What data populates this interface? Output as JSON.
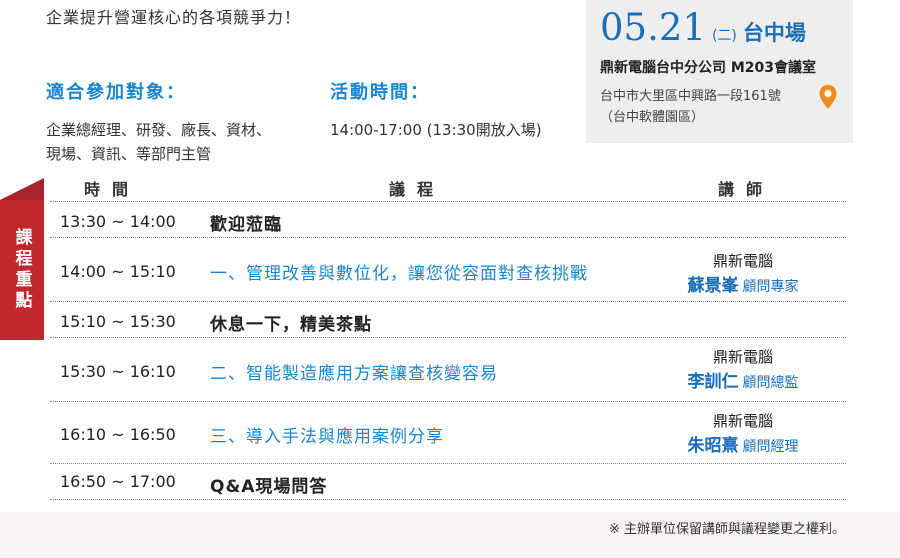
{
  "intro": "企業提升營運核心的各項競爭力！",
  "audience": {
    "heading": "適合參加對象：",
    "line1": "企業總經理、研發、廠長、資材、",
    "line2": "現場、資訊、等部門主管"
  },
  "event_time": {
    "heading": "活動時間：",
    "text": "14:00-17:00 (13:30開放入場)"
  },
  "date_box": {
    "date": "05.21",
    "weekday": "(二)",
    "venue": "台中場",
    "place": "鼎新電腦台中分公司 M203會議室",
    "address": "台中市大里區中興路一段161號",
    "address_note": "（台中軟體園區）"
  },
  "side_tab": "課程重點",
  "table": {
    "headers": {
      "time": "時間",
      "agenda": "議程",
      "speaker": "講師"
    },
    "rows": [
      {
        "time": "13:30 ~ 14:00",
        "topic": "歡迎蒞臨"
      },
      {
        "time": "14:00 ~ 15:10",
        "topic": "一、管理改善與數位化，讓您從容面對查核挑戰",
        "org": "鼎新電腦",
        "name": "蘇景峯",
        "title": "顧問專家"
      },
      {
        "time": "15:10 ~ 15:30",
        "topic": "休息一下，精美茶點"
      },
      {
        "time": "15:30 ~ 16:10",
        "topic": "二、智能製造應用方案讓查核變容易",
        "org": "鼎新電腦",
        "name": "李訓仁",
        "title": "顧問總監"
      },
      {
        "time": "16:10 ~ 16:50",
        "topic": "三、導入手法與應用案例分享",
        "org": "鼎新電腦",
        "name": "朱昭熹",
        "title": "顧問經理"
      },
      {
        "time": "16:50 ~ 17:00",
        "topic": "Q&A現場問答"
      }
    ]
  },
  "footer_note": "※ 主辦單位保留講師與議程變更之權利。",
  "colors": {
    "accent_blue": "#1a86d0",
    "tab_red": "#c1272d",
    "pin_orange": "#f08c1e"
  },
  "icons": {
    "location": "map-pin-icon"
  }
}
